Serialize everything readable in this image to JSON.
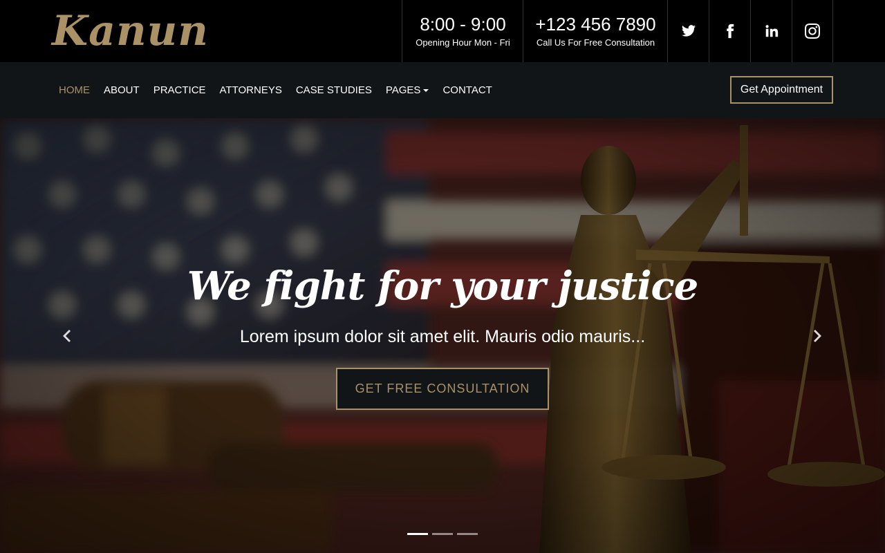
{
  "brand": {
    "logo_text": "Kanun",
    "accent": "#aa9166"
  },
  "top_info": {
    "hours": {
      "value": "8:00 - 9:00",
      "label": "Opening Hour Mon - Fri"
    },
    "phone": {
      "value": "+123 456 7890",
      "label": "Call Us For Free Consultation"
    }
  },
  "social": [
    {
      "icon": "twitter-icon"
    },
    {
      "icon": "facebook-icon"
    },
    {
      "icon": "linkedin-icon"
    },
    {
      "icon": "instagram-icon"
    }
  ],
  "nav": {
    "items": [
      {
        "label": "HOME",
        "active": true
      },
      {
        "label": "ABOUT"
      },
      {
        "label": "PRACTICE"
      },
      {
        "label": "ATTORNEYS"
      },
      {
        "label": "CASE STUDIES"
      },
      {
        "label": "PAGES",
        "dropdown": true
      },
      {
        "label": "CONTACT"
      }
    ],
    "cta_label": "Get Appointment"
  },
  "hero": {
    "title": "We fight for your justice",
    "subtitle": "Lorem ipsum dolor sit amet elit. Mauris odio mauris...",
    "button_label": "GET FREE CONSULTATION",
    "slides_count": 3,
    "active_slide": 1
  }
}
